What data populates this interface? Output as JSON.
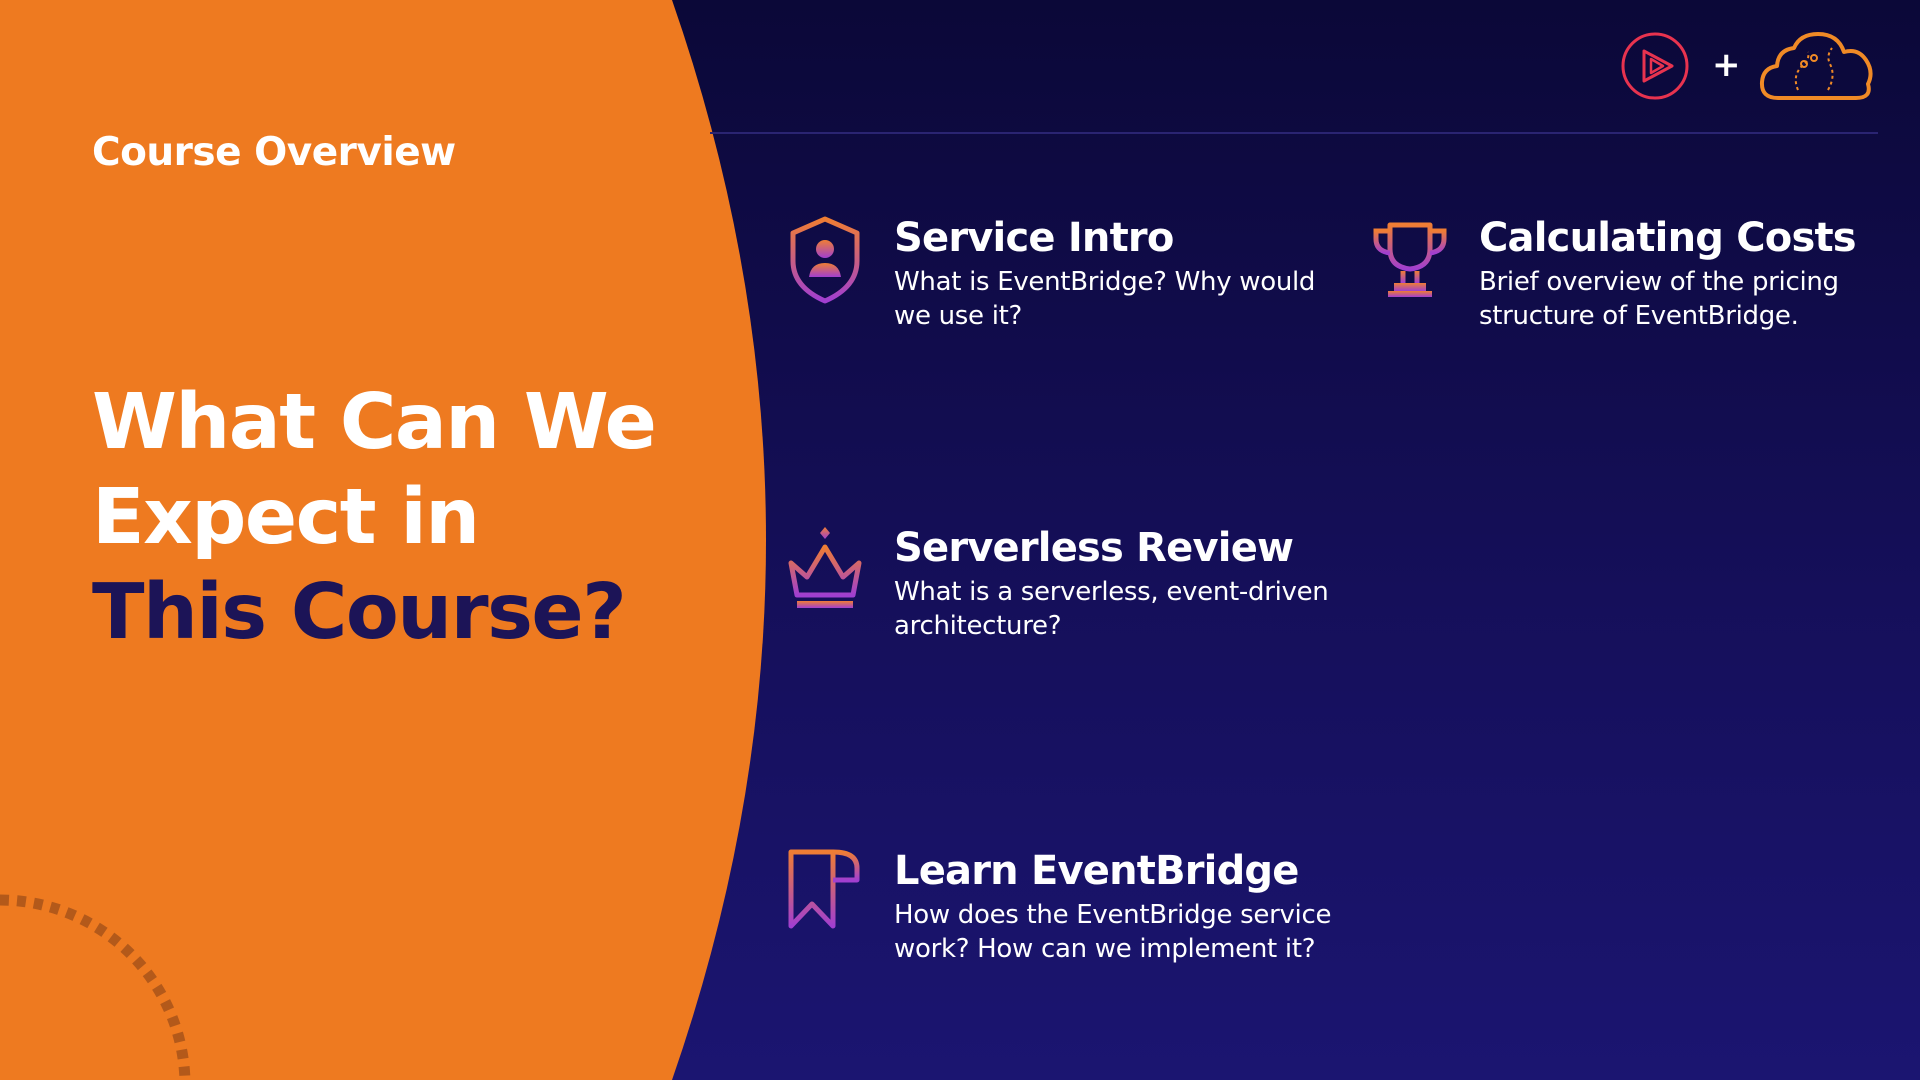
{
  "slide": {
    "section_label": "Course Overview",
    "title_lines": [
      "What Can We",
      "Expect in",
      "This Course?"
    ],
    "colors": {
      "orange": "#ee7a20",
      "navy": "#150f5a",
      "title_dark": "#1c1457",
      "play_ring": "#e8334f",
      "cloud": "#f08a26"
    }
  },
  "brand": {
    "play_icon": "play-circle-icon",
    "plus": "+",
    "cloud_icon": "cloud-icon"
  },
  "topics": [
    {
      "title": "Service Intro",
      "desc_lines": [
        "What is EventBridge? Why would",
        "we use it?"
      ],
      "icon": "shield-user-icon"
    },
    {
      "title": "Calculating Costs",
      "desc_lines": [
        "Brief overview of the pricing",
        "structure of EventBridge."
      ],
      "icon": "trophy-icon"
    },
    {
      "title": "Serverless Review",
      "desc_lines": [
        "What is a serverless, event-driven",
        "architecture?"
      ],
      "icon": "crown-icon"
    },
    {
      "title": "Learn EventBridge",
      "desc_lines": [
        "How does the EventBridge service",
        "work? How can we implement it?"
      ],
      "icon": "bookmark-icon"
    }
  ]
}
